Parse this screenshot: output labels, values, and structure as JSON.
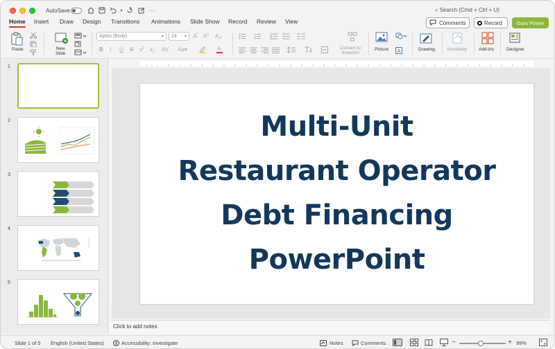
{
  "titlebar": {
    "autosave_label": "AutoSave",
    "search_placeholder": "Search (Cmd + Ctrl + U)"
  },
  "tabs": [
    {
      "label": "Home",
      "active": true
    },
    {
      "label": "Insert"
    },
    {
      "label": "Draw"
    },
    {
      "label": "Design"
    },
    {
      "label": "Transitions"
    },
    {
      "label": "Animations"
    },
    {
      "label": "Slide Show"
    },
    {
      "label": "Record"
    },
    {
      "label": "Review"
    },
    {
      "label": "View"
    }
  ],
  "header_buttons": {
    "comments": "Comments",
    "record": "Record",
    "guru": "Guru Power"
  },
  "ribbon": {
    "paste": "Paste",
    "new_slide": "New\nSlide",
    "font_name": "Aptos (Body)",
    "font_size": "24",
    "convert_smartart": "Convert to\nSmartArt",
    "picture": "Picture",
    "drawing": "Drawing",
    "sensitivity": "Sensitivity",
    "addins": "Add-ins",
    "designer": "Designer"
  },
  "thumbnails": [
    {
      "number": "1",
      "selected": true
    },
    {
      "number": "2"
    },
    {
      "number": "3"
    },
    {
      "number": "4"
    },
    {
      "number": "5"
    }
  ],
  "slide": {
    "title_lines": [
      "Multi-Unit",
      "Restaurant Operator",
      "Debt Financing",
      "PowerPoint"
    ]
  },
  "notes_placeholder": "Click to add notes",
  "status": {
    "slide_of": "Slide 1 of 5",
    "language": "English (United States)",
    "accessibility": "Accessibility: Investigate",
    "notes": "Notes",
    "comments": "Comments",
    "zoom": "99%"
  },
  "colors": {
    "accent_tab": "#c43e1c",
    "guru_green": "#8db63c",
    "slide_title": "#13385a",
    "thumb_green": "#8db63c",
    "thumb_navy": "#1f4e6e"
  }
}
